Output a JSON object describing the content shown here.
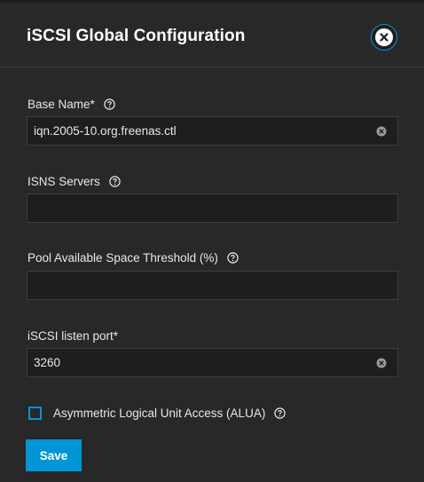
{
  "dialog": {
    "title": "iSCSI Global Configuration",
    "close_icon": "close-circle-icon"
  },
  "fields": {
    "base_name": {
      "label": "Base Name",
      "required_mark": "*",
      "value": "iqn.2005-10.org.freenas.ctl",
      "placeholder": ""
    },
    "isns_servers": {
      "label": "ISNS Servers",
      "value": "",
      "placeholder": ""
    },
    "pool_threshold": {
      "label": "Pool Available Space Threshold (%)",
      "value": "",
      "placeholder": ""
    },
    "listen_port": {
      "label": "iSCSI listen port",
      "required_mark": "*",
      "value": "3260",
      "placeholder": ""
    },
    "alua": {
      "label": "Asymmetric Logical Unit Access (ALUA)",
      "checked": false
    }
  },
  "actions": {
    "save_label": "Save"
  },
  "colors": {
    "background": "#282828",
    "input_background": "#1e1e1e",
    "accent": "#0095d5",
    "text": "#e8e8e8"
  }
}
